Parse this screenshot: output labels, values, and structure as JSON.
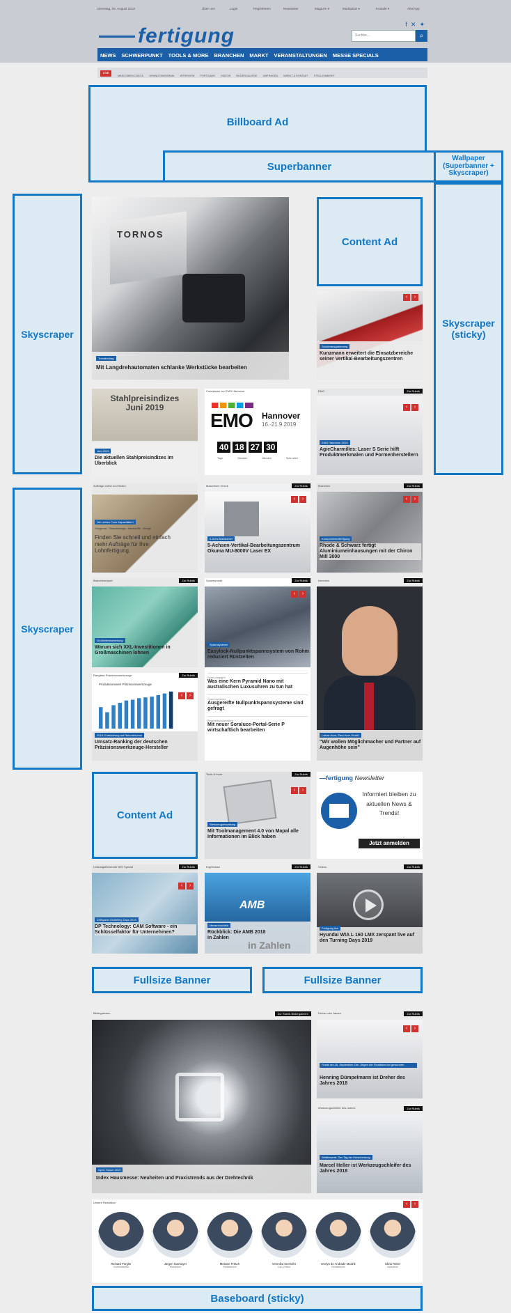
{
  "header": {
    "date": "Dienstag, 06. August 2019",
    "top_links": [
      "Über uns",
      "Login",
      "Registrieren",
      "Newsletter",
      "Magazin ▾",
      "Marktplatz ▾",
      "Kontakt ▾",
      "Abo/App"
    ],
    "logo": "fertigung",
    "search_placeholder": "Suchbe...",
    "main_nav": [
      "NEWS",
      "SCHWERPUNKT",
      "TOOLS & MORE",
      "BRANCHEN",
      "MARKT",
      "VERANSTALTUNGEN",
      "MESSE SPECIALS"
    ],
    "live_badge": "LIVE",
    "sub_nav": [
      "MASCHINEN-CHECK",
      "GRAND PANORAMA",
      "INTERVIEW",
      "FORTGANG",
      "VIDEOS",
      "BILDERGALERIE",
      "UMFRAGEN",
      "MARKT & KONTAKT",
      "STELLENMARKT"
    ]
  },
  "ads": {
    "billboard": "Billboard Ad",
    "superbanner": "Superbanner",
    "wallpaper": "Wallpaper\n(Superbanner +\nSkyscraper)",
    "skyscraper_left_1": "Skyscraper",
    "skyscraper_left_2": "Skyscraper",
    "skyscraper_sticky": "Skyscraper\n(sticky)",
    "content_ad_1": "Content Ad",
    "content_ad_2": "Content Ad",
    "fullsize_1": "Fullsize Banner",
    "fullsize_2": "Fullsize Banner",
    "baseboard": "Baseboard (sticky)"
  },
  "teaser": {
    "brand_text": "TORNOS",
    "category": "Trendbeitrag",
    "headline": "Mit Langdrehautomaten schlanke Werkstücke bearbeiten"
  },
  "cards": {
    "kunzmann": {
      "category": "Sonderausgabenang",
      "headline": "Kunzmann erweitert die Einsatzbereiche seiner Vertikal-Bearbeitungszentren"
    },
    "stahl": {
      "image_title": "Stahlpreisindizes\nJuni 2019",
      "category": "Juni 2019",
      "headline": "Die aktuellen Stahlpreisindizes im Überblick"
    },
    "emo": {
      "header": "Countdown zur EMO Hannover",
      "logo": "EMO",
      "city": "Hannover",
      "dates": "16.-21.9.2019",
      "countdown": [
        "40",
        "18",
        "27",
        "30"
      ],
      "units": [
        "Tage",
        "Stunden",
        "Minuten",
        "Sekunden"
      ]
    },
    "agie": {
      "header": "EMO",
      "rubric": "Zur Rubrik",
      "category": "EMO Hannover 2019",
      "headline": "AgieCharmilles: Laser S Serie hilft Produktmerkmalen und Formenherstellern"
    },
    "auftraege": {
      "header": "Aufträge online und finden",
      "category": "Die Lieben Freie Kapazitäten!",
      "subtitle": "Ortsgenau · Maschinentyp · Werkstoffe · Menge",
      "body": "Finden Sie schnell und einfach mehr Aufträge für Ihre Lohnfertigung."
    },
    "okuma": {
      "header": "Maschinen Check",
      "rubric": "Zur Rubrik",
      "category": "5-Achs-Maßbohrer",
      "headline": "5-Achsen-Vertikal-Bearbeitungszentrum Okuma MU-8000V Laser EX"
    },
    "chiron": {
      "header": "Branchen",
      "rubric": "Zur Rubrik",
      "category": "Komponentenfertigung",
      "headline": "Rhode & Schwarz fertigt Aluminiumeinhausungen mit der Chiron Mill 3000"
    },
    "gross": {
      "header": "Branchenreport",
      "rubric": "Zur Rubrik",
      "category": "Großteilebearbeitung",
      "headline": "Warum sich XXL-Investitionen in Großmaschinen lohnen"
    },
    "spann": {
      "header": "Schwerpunkt",
      "rubric": "Zur Rubrik",
      "category": "Spannsysteme",
      "headline": "Easylock-Nullpunktspannsystem von Rohm reduziert Rüstzeiten",
      "list": [
        {
          "label": "Spannungsfrei",
          "text": "Was eine Kern Pyramid Nano mit australischen Luxusuhren zu tun hat"
        },
        {
          "label": "Spannsysteme",
          "text": "Ausgereifte Nullpunktspannsysteme sind gefragt"
        },
        {
          "label": "Bearbeitungszentren",
          "text": "Mit neuer Soraluce-Portal-Serie P wirtschaftlich bearbeiten"
        }
      ]
    },
    "interview": {
      "header": "Interview",
      "rubric": "Zur Rubrik",
      "category": "Lothar Horn, Paul Horn GmbH",
      "headline": "\"Wir wollen Möglichmacher und Partner auf Augenhöhe sein\""
    },
    "ranking": {
      "header": "Rangliste Präzisionswerkzeuge",
      "rubric": "Zur Rubrik",
      "chart_title": "Produktionswert Präzisionswerkzeuge",
      "category": "2018: Entwicklung auf Rekordniveau",
      "headline": "Umsatz-Ranking der deutschen Präzisionswerkzeuge-Hersteller"
    },
    "tools": {
      "header": "Tools & more",
      "rubric": "Zur Rubrik",
      "category": "Werkzeugverwaltung",
      "headline": "Mit Toolmanagement 4.0 von Mapal alle Informationen im Blick haben"
    },
    "newsletter": {
      "logo": "fertigung",
      "title": "Newsletter",
      "text": "Informiert bleiben zu aktuellen News & Trends!",
      "button": "Jetzt anmelden"
    },
    "cam": {
      "header": "Leistungsführender WIS Special",
      "rubric": "Zur Rubrik",
      "category": "Zeitsparer-Modelling Days 2019",
      "headline": "DP Technology: CAM Software - ein Schlüsselfaktor für Unternehmen?"
    },
    "amb": {
      "header": "Ergebnisse",
      "rubric": "Zur Rubrik",
      "logo": "AMB",
      "category": "Messerückblick",
      "headline": "Rückblick: Die AMB 2018 in Zahlen",
      "overlay": "in Zahlen"
    },
    "hyundai": {
      "header": "Videos",
      "rubric": "Zur Rubrik",
      "category": "Fertigung live",
      "headline": "Hyundai WIA L 160 LMX zerspant live auf den Turning Days 2019"
    },
    "gallery": {
      "header": "Bildergalerien",
      "rubric": "Zur Rubrik Bildergalerien",
      "category": "Open House 2019",
      "headline": "Index Hausmesse: Neuheiten und Praxistrends aus der Drehtechnik"
    },
    "dreher": {
      "header": "Dreher des Jahres",
      "rubric": "Zur Rubrik",
      "category": "Finale am 26. September: Der Jürgen der Finalisten hat gewonnen",
      "headline": "Henning Dümpelmann ist Dreher des Jahres 2018"
    },
    "schleifer": {
      "header": "Werkzeugschleifer des Jahres",
      "rubric": "Zur Rubrik",
      "category": "Wettbewerb: Der Tag der Entscheidung",
      "headline": "Marcel Heller ist Werkzeugschleifer des Jahres 2018"
    }
  },
  "team": {
    "header": "Unsere Redaktion",
    "members": [
      {
        "name": "Richard Pergler",
        "role": "Chefredakteur"
      },
      {
        "name": "Jürgen Gutmayer",
        "role": "Redakteur"
      },
      {
        "name": "Melanie Fritsch",
        "role": "Redakteurin"
      },
      {
        "name": "Veronika Seehofer",
        "role": "CvD Online"
      },
      {
        "name": "Evelyn de Andrade Mozzik",
        "role": "Redakteurin"
      },
      {
        "name": "Silvia Reiter",
        "role": "Assistenz"
      }
    ]
  },
  "chart_data": {
    "type": "bar",
    "title": "Produktionswert Präzisionswerkzeuge",
    "categories": [
      "1",
      "2",
      "3",
      "4",
      "5",
      "6",
      "7",
      "8",
      "9",
      "10",
      "11",
      "12"
    ],
    "values": [
      55,
      42,
      60,
      66,
      72,
      74,
      78,
      80,
      82,
      86,
      90,
      95
    ],
    "ylim": [
      0,
      100
    ]
  },
  "colors": {
    "brand": "#1a5fa8",
    "ad_border": "#1278c6",
    "ad_fill": "#dceaf4",
    "accent_red": "#d0322f"
  }
}
